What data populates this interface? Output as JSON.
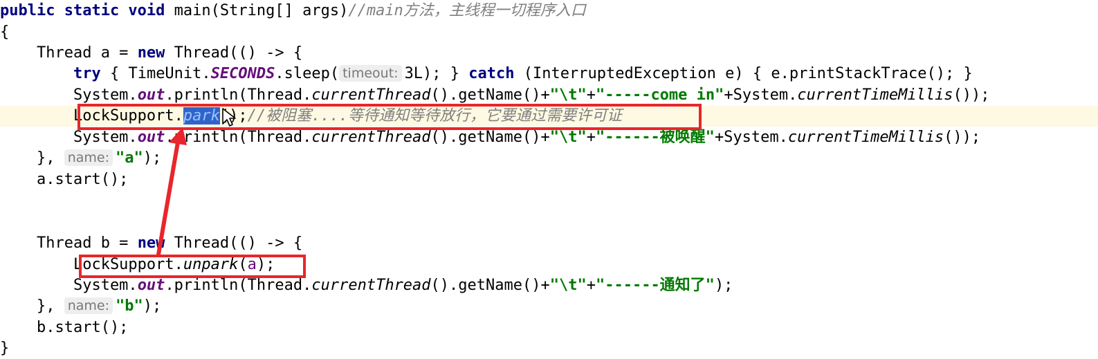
{
  "code": {
    "line1": {
      "kw": "public static void",
      "sig": " main(String[] args)",
      "comment": "//main方法，主线程一切程序入口"
    },
    "line2": {
      "text": "{"
    },
    "line3": {
      "pre": "    Thread a = ",
      "kw": "new",
      "post": " Thread(() -> {"
    },
    "line4": {
      "indent": "        ",
      "kw_try": "try",
      "t1": " { TimeUnit.",
      "field": "SECONDS",
      "t2": ".sleep(",
      "hint": "timeout:",
      "t3": "3L); } ",
      "kw_catch": "catch",
      "t4": " (InterruptedException e) { e.printStackTrace(); }"
    },
    "line5": {
      "indent": "        System.",
      "field": "out",
      "t1": ".println(Thread.",
      "m1": "currentThread",
      "t2": "().getName()+",
      "s1": "\"\\t\"",
      "t3": "+",
      "s2": "\"-----come in\"",
      "t4": "+System.",
      "m2": "currentTimeMillis",
      "t5": "());"
    },
    "line6": {
      "indent": "        LockSupport.",
      "method_selected": "park",
      "t1": "();",
      "comment": "//被阻塞....等待通知等待放行，它要通过需要许可证"
    },
    "line7": {
      "indent": "        System.",
      "field": "out",
      "t1": ".println(Thread.",
      "m1": "currentThread",
      "t2": "().getName()+",
      "s1": "\"\\t\"",
      "t3": "+",
      "s2": "\"------被唤醒\"",
      "t4": "+System.",
      "m2": "currentTimeMillis",
      "t5": "());"
    },
    "line8": {
      "pre": "    }, ",
      "hint": "name:",
      "s": "\"a\"",
      "post": ");"
    },
    "line9": {
      "text": "    a.start();"
    },
    "line10": {
      "pre": "    Thread b = ",
      "kw": "new",
      "post": " Thread(() -> {"
    },
    "line11": {
      "indent": "        LockSupport.",
      "method": "unpark",
      "t1": "(",
      "var": "a",
      "t2": ");"
    },
    "line12": {
      "indent": "        System.",
      "field": "out",
      "t1": ".println(Thread.",
      "m1": "currentThread",
      "t2": "().getName()+",
      "s1": "\"\\t\"",
      "t3": "+",
      "s2": "\"------通知了\"",
      "t4": ");"
    },
    "line13": {
      "pre": "    }, ",
      "hint": "name:",
      "s": "\"b\"",
      "post": ");"
    },
    "line14": {
      "text": "    b.start();"
    },
    "line15": {
      "text": "}"
    }
  },
  "annotations": {
    "box_color": "#e8262b",
    "arrow_color": "#e8262b",
    "current_line_color": "#fdf9e2",
    "selection_color": "#2f65ca"
  }
}
